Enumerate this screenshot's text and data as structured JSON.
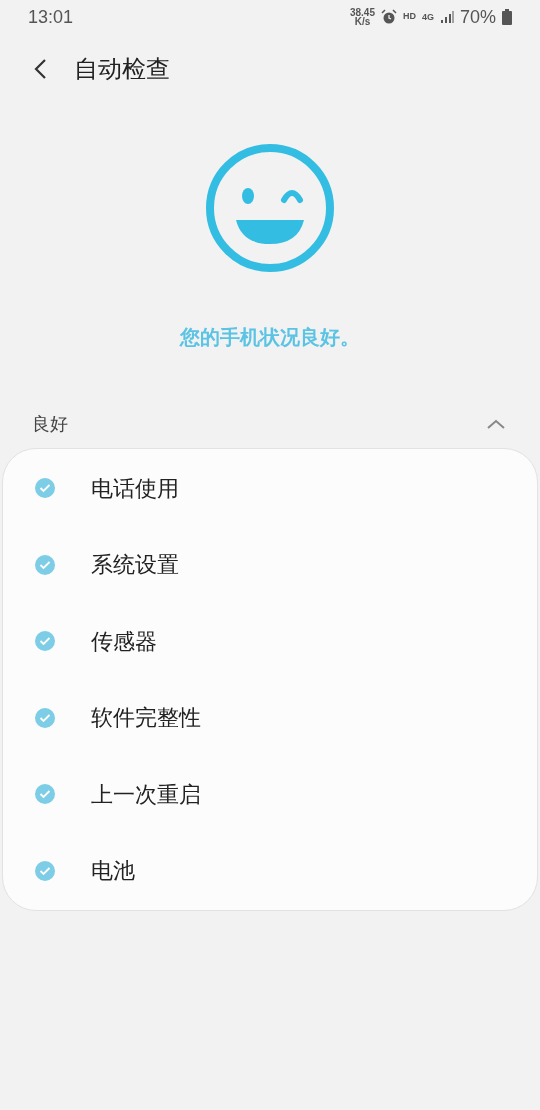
{
  "status_bar": {
    "time": "13:01",
    "speed_value": "38.45",
    "speed_unit": "K/s",
    "hd": "HD",
    "network": "4G",
    "battery": "70%"
  },
  "header": {
    "title": "自动检查"
  },
  "status_message": "您的手机状况良好。",
  "section": {
    "title": "良好",
    "expanded": true,
    "items": [
      {
        "label": "电话使用",
        "checked": true
      },
      {
        "label": "系统设置",
        "checked": true
      },
      {
        "label": "传感器",
        "checked": true
      },
      {
        "label": "软件完整性",
        "checked": true
      },
      {
        "label": "上一次重启",
        "checked": true
      },
      {
        "label": "电池",
        "checked": true
      }
    ]
  }
}
